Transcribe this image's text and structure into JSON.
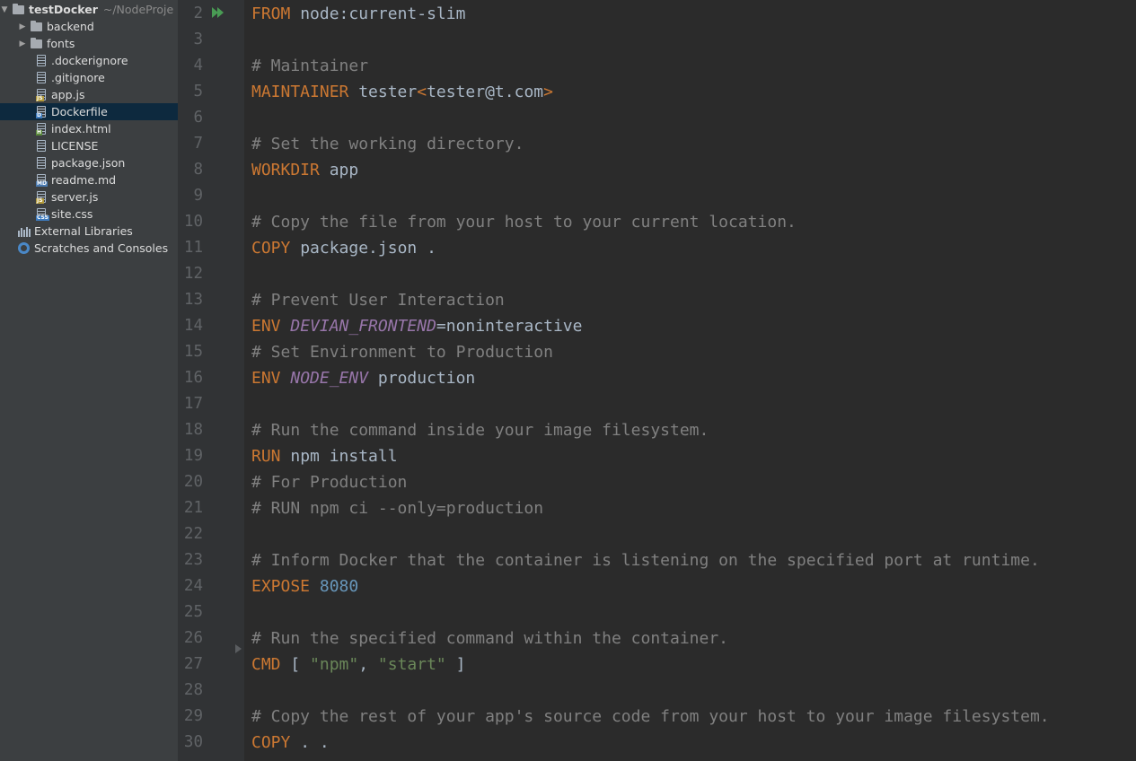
{
  "project": {
    "root": {
      "name": "testDocker",
      "path": "~/NodeProje"
    },
    "items": [
      {
        "label": "backend",
        "type": "folder"
      },
      {
        "label": "fonts",
        "type": "folder"
      },
      {
        "label": ".dockerignore",
        "type": "file",
        "badge": ""
      },
      {
        "label": ".gitignore",
        "type": "file",
        "badge": ""
      },
      {
        "label": "app.js",
        "type": "file",
        "badge": "JS"
      },
      {
        "label": "Dockerfile",
        "type": "file",
        "badge": "D",
        "selected": true
      },
      {
        "label": "index.html",
        "type": "file",
        "badge": "H"
      },
      {
        "label": "LICENSE",
        "type": "file",
        "badge": ""
      },
      {
        "label": "package.json",
        "type": "file",
        "badge": ""
      },
      {
        "label": "readme.md",
        "type": "file",
        "badge": "MD"
      },
      {
        "label": "server.js",
        "type": "file",
        "badge": "JS"
      },
      {
        "label": "site.css",
        "type": "file",
        "badge": "CSS"
      }
    ],
    "external_libraries": "External Libraries",
    "scratches": "Scratches and Consoles"
  },
  "colors": {
    "keyword": "#cc7832",
    "comment": "#808080",
    "env_var": "#9876aa",
    "string": "#6a8759",
    "number": "#6897bb",
    "text": "#a9b7c6",
    "run_icon": "#499c54"
  },
  "editor": {
    "lines": [
      {
        "n": "2",
        "kw": "FROM",
        "rest": " node:current-slim"
      },
      {
        "n": "3"
      },
      {
        "n": "4",
        "comment": "# Maintainer"
      },
      {
        "n": "5",
        "kw": "MAINTAINER",
        "rest": " tester",
        "kw2": "<",
        "rest2": "tester@t.com",
        "kw3": ">"
      },
      {
        "n": "6"
      },
      {
        "n": "7",
        "comment": "# Set the working directory."
      },
      {
        "n": "8",
        "kw": "WORKDIR",
        "rest": " app"
      },
      {
        "n": "9"
      },
      {
        "n": "10",
        "comment": "# Copy the file from your host to your current location."
      },
      {
        "n": "11",
        "kw": "COPY",
        "rest": " package.json ."
      },
      {
        "n": "12"
      },
      {
        "n": "13",
        "comment": "# Prevent User Interaction"
      },
      {
        "n": "14",
        "kw": "ENV",
        "sp": " ",
        "var": "DEVIAN_FRONTEND",
        "rest": "=noninteractive"
      },
      {
        "n": "15",
        "comment": "# Set Environment to Production"
      },
      {
        "n": "16",
        "kw": "ENV",
        "sp": " ",
        "var": "NODE_ENV",
        "rest": " production"
      },
      {
        "n": "17"
      },
      {
        "n": "18",
        "comment": "# Run the command inside your image filesystem."
      },
      {
        "n": "19",
        "kw": "RUN",
        "rest": " npm install"
      },
      {
        "n": "20",
        "comment": "# For Production"
      },
      {
        "n": "21",
        "comment": "# RUN npm ci --only=production"
      },
      {
        "n": "22"
      },
      {
        "n": "23",
        "comment": "# Inform Docker that the container is listening on the specified port at runtime."
      },
      {
        "n": "24",
        "kw": "EXPOSE",
        "sp": " ",
        "num": "8080"
      },
      {
        "n": "25"
      },
      {
        "n": "26",
        "comment": "# Run the specified command within the container."
      },
      {
        "n": "27",
        "kw": "CMD",
        "rest": " [ ",
        "str": "\"npm\"",
        "rest2": ", ",
        "str2": "\"start\"",
        "rest3": " ]"
      },
      {
        "n": "28"
      },
      {
        "n": "29",
        "comment": "# Copy the rest of your app's source code from your host to your image filesystem."
      },
      {
        "n": "30",
        "kw": "COPY",
        "rest": " . ."
      }
    ]
  }
}
